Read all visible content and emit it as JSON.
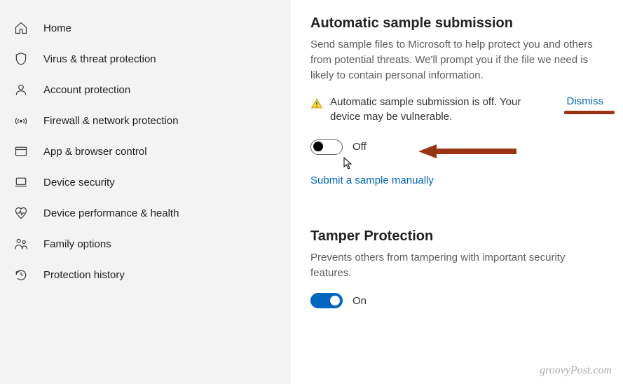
{
  "sidebar": {
    "items": [
      {
        "label": "Home"
      },
      {
        "label": "Virus & threat protection"
      },
      {
        "label": "Account protection"
      },
      {
        "label": "Firewall & network protection"
      },
      {
        "label": "App & browser control"
      },
      {
        "label": "Device security"
      },
      {
        "label": "Device performance & health"
      },
      {
        "label": "Family options"
      },
      {
        "label": "Protection history"
      }
    ]
  },
  "main": {
    "auto_submission": {
      "title": "Automatic sample submission",
      "desc": "Send sample files to Microsoft to help protect you and others from potential threats. We'll prompt you if the file we need is likely to contain personal information.",
      "warning_text": "Automatic sample submission is off. Your device may be vulnerable.",
      "dismiss_label": "Dismiss",
      "toggle_state": "Off",
      "submit_link": "Submit a sample manually"
    },
    "tamper": {
      "title": "Tamper Protection",
      "desc": "Prevents others from tampering with important security features.",
      "toggle_state": "On"
    }
  },
  "watermark": "groovyPost.com"
}
